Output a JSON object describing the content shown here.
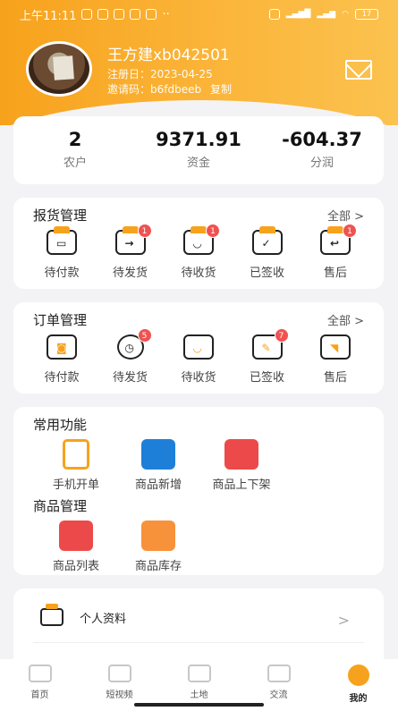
{
  "status": {
    "time": "上午11:11",
    "battery": "17"
  },
  "profile": {
    "name": "王方建xb042501",
    "reg_label": "注册日：",
    "reg_date": "2023-04-25",
    "invite_label": "邀请码：",
    "invite_code": "b6fdbeeb",
    "copy": "复制"
  },
  "stats": [
    {
      "value": "2",
      "label": "农户"
    },
    {
      "value": "9371.91",
      "label": "资金"
    },
    {
      "value": "-604.37",
      "label": "分润"
    }
  ],
  "report": {
    "title": "报货管理",
    "all": "全部 >",
    "items": [
      {
        "label": "待付款",
        "badge": ""
      },
      {
        "label": "待发货",
        "badge": "1"
      },
      {
        "label": "待收货",
        "badge": "1"
      },
      {
        "label": "已签收",
        "badge": ""
      },
      {
        "label": "售后",
        "badge": "1"
      }
    ]
  },
  "orders": {
    "title": "订单管理",
    "all": "全部 >",
    "items": [
      {
        "label": "待付款",
        "badge": ""
      },
      {
        "label": "待发货",
        "badge": "5"
      },
      {
        "label": "待收货",
        "badge": ""
      },
      {
        "label": "已签收",
        "badge": "7"
      },
      {
        "label": "售后",
        "badge": ""
      }
    ]
  },
  "common": {
    "title": "常用功能",
    "items": [
      {
        "label": "手机开单",
        "color": "#f7a21c"
      },
      {
        "label": "商品新增",
        "color": "#1e7fd8"
      },
      {
        "label": "商品上下架",
        "color": "#ec4a4a"
      }
    ]
  },
  "goods": {
    "title": "商品管理",
    "items": [
      {
        "label": "商品列表",
        "color": "#ec4a4a"
      },
      {
        "label": "商品库存",
        "color": "#f7923a"
      }
    ]
  },
  "menu": {
    "profile": "个人资料",
    "arrow": ">"
  },
  "tabs": [
    {
      "label": "首页"
    },
    {
      "label": "短视频"
    },
    {
      "label": "土地"
    },
    {
      "label": "交流"
    },
    {
      "label": "我的"
    }
  ]
}
